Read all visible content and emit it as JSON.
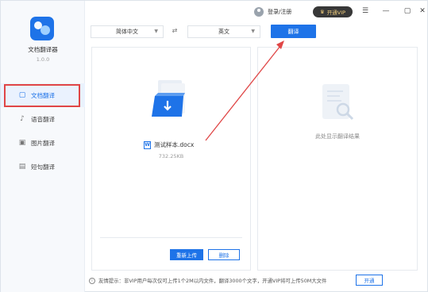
{
  "app": {
    "name": "文档翻译器",
    "version": "1.0.0"
  },
  "sidebar": {
    "items": [
      {
        "label": "文档翻译",
        "icon": "document-icon",
        "active": true
      },
      {
        "label": "语音翻译",
        "icon": "microphone-icon",
        "active": false
      },
      {
        "label": "图片翻译",
        "icon": "image-icon",
        "active": false
      },
      {
        "label": "短句翻译",
        "icon": "text-icon",
        "active": false
      }
    ]
  },
  "titlebar": {
    "login_label": "登录/注册",
    "vip_label": "开通VIP",
    "settings_glyph": "☰",
    "minimize_glyph": "—",
    "close_glyph": "✕"
  },
  "toolbar": {
    "source_lang": "简体中文",
    "target_lang": "英文",
    "swap_glyph": "⇄",
    "translate_label": "翻译"
  },
  "source_panel": {
    "file_name": "测试样本.docx",
    "file_type_glyph": "W",
    "file_size": "732.25KB",
    "reupload_label": "重新上传",
    "delete_label": "删除"
  },
  "result_panel": {
    "placeholder": "此处显示翻译结果"
  },
  "footer": {
    "tip": "友情提示：非VIP用户每次仅可上传1个2M以内文件，翻译3000个文字，开通VIP将可上传50M大文件",
    "open_label": "开通"
  },
  "colors": {
    "accent": "#1e73e8",
    "highlight_red": "#e04646",
    "vip_dark": "#383838",
    "vip_gold": "#f3cf7d"
  }
}
